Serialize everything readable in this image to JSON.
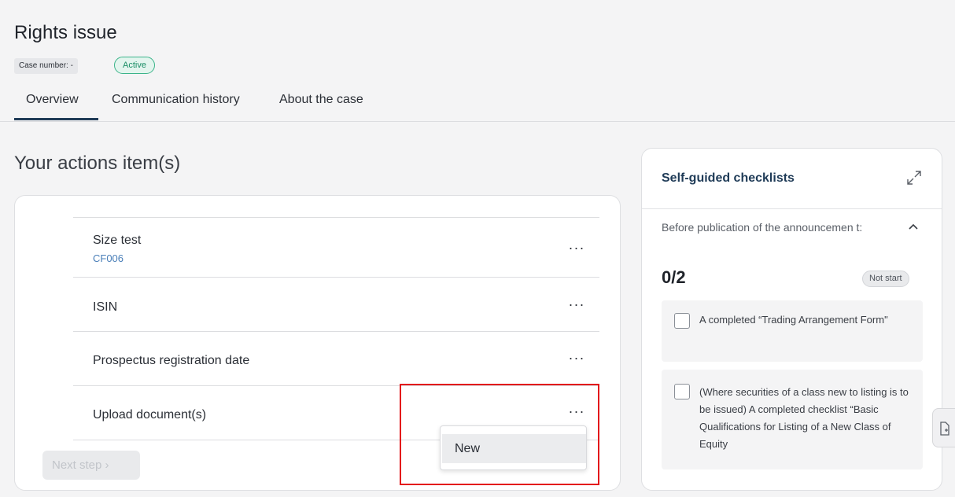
{
  "header": {
    "title": "Rights issue",
    "case_number": "Case number: -",
    "status": "Active",
    "tabs": [
      {
        "label": "Overview",
        "active": true
      },
      {
        "label": "Communication history",
        "active": false
      },
      {
        "label": "About the case",
        "active": false
      }
    ]
  },
  "actions": {
    "title": "Your actions item(s)",
    "items": [
      {
        "label": "Size test",
        "sub": "CF006"
      },
      {
        "label": "ISIN",
        "sub": ""
      },
      {
        "label": "Prospectus registration date",
        "sub": ""
      },
      {
        "label": "Upload document(s)",
        "sub": ""
      }
    ],
    "more_label": "···",
    "next_button": "Next step  ›",
    "dropdown_items": [
      "New"
    ]
  },
  "checklist": {
    "title": "Self-guided checklists",
    "section_label": "Before publication of the announcemen t:",
    "progress": "0/2",
    "status": "Not start",
    "items": [
      {
        "text": "A completed “Trading Arrangement Form\"",
        "checked": false
      },
      {
        "text": "(Where securities of a class new to listing is to be issued) A completed checklist “Basic Qualifications for Listing of a New Class of Equity",
        "checked": false
      }
    ]
  },
  "icons": {
    "expand": "expand-diagonal-icon",
    "collapse": "chevron-up-icon",
    "side_tab": "document-add-icon"
  },
  "colors": {
    "highlight": "#e3161b",
    "status_active": "#3bb48a",
    "link": "#4a7fb8"
  }
}
